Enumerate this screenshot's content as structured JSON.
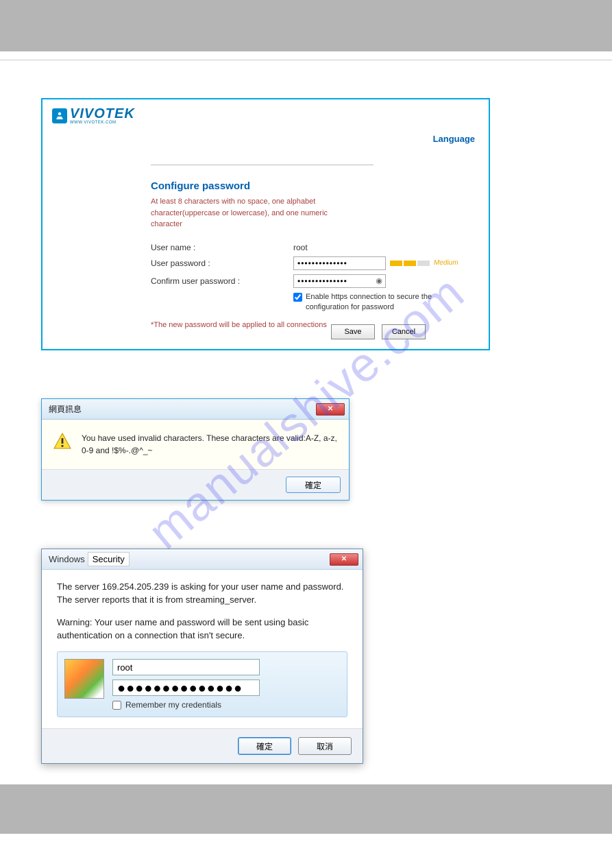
{
  "vivotek": {
    "logo_text": "VIVOTEK",
    "logo_sub": "WWW.VIVOTEK.COM",
    "language_link": "Language",
    "title": "Configure password",
    "desc": "At least 8 characters with no space, one alphabet character(uppercase or lowercase), and one numeric character",
    "username_label": "User name :",
    "username_value": "root",
    "password_label": "User password :",
    "password_value": "••••••••••••••",
    "strength_label": "Medium",
    "confirm_label": "Confirm user password :",
    "confirm_value": "••••••••••••••",
    "checkbox_label": "Enable https connection to secure the configuration for password",
    "note": "*The new password will be applied to all connections",
    "save_btn": "Save",
    "cancel_btn": "Cancel"
  },
  "msg": {
    "title": "網頁訊息",
    "text": "You have used invalid characters. These characters are valid:A-Z, a-z, 0-9 and !$%-.@^_~",
    "ok_btn": "確定"
  },
  "sec": {
    "title_prefix": "Windows",
    "title_main": "Security",
    "line1": "The server 169.254.205.239 is asking for your user name and password. The server reports that it is from streaming_server.",
    "line2": "Warning: Your user name and password will be sent using basic authentication on a connection that isn't secure.",
    "username_value": "root",
    "password_dots": "●●●●●●●●●●●●●●",
    "remember_label": "Remember my credentials",
    "ok_btn": "確定",
    "cancel_btn": "取消"
  }
}
